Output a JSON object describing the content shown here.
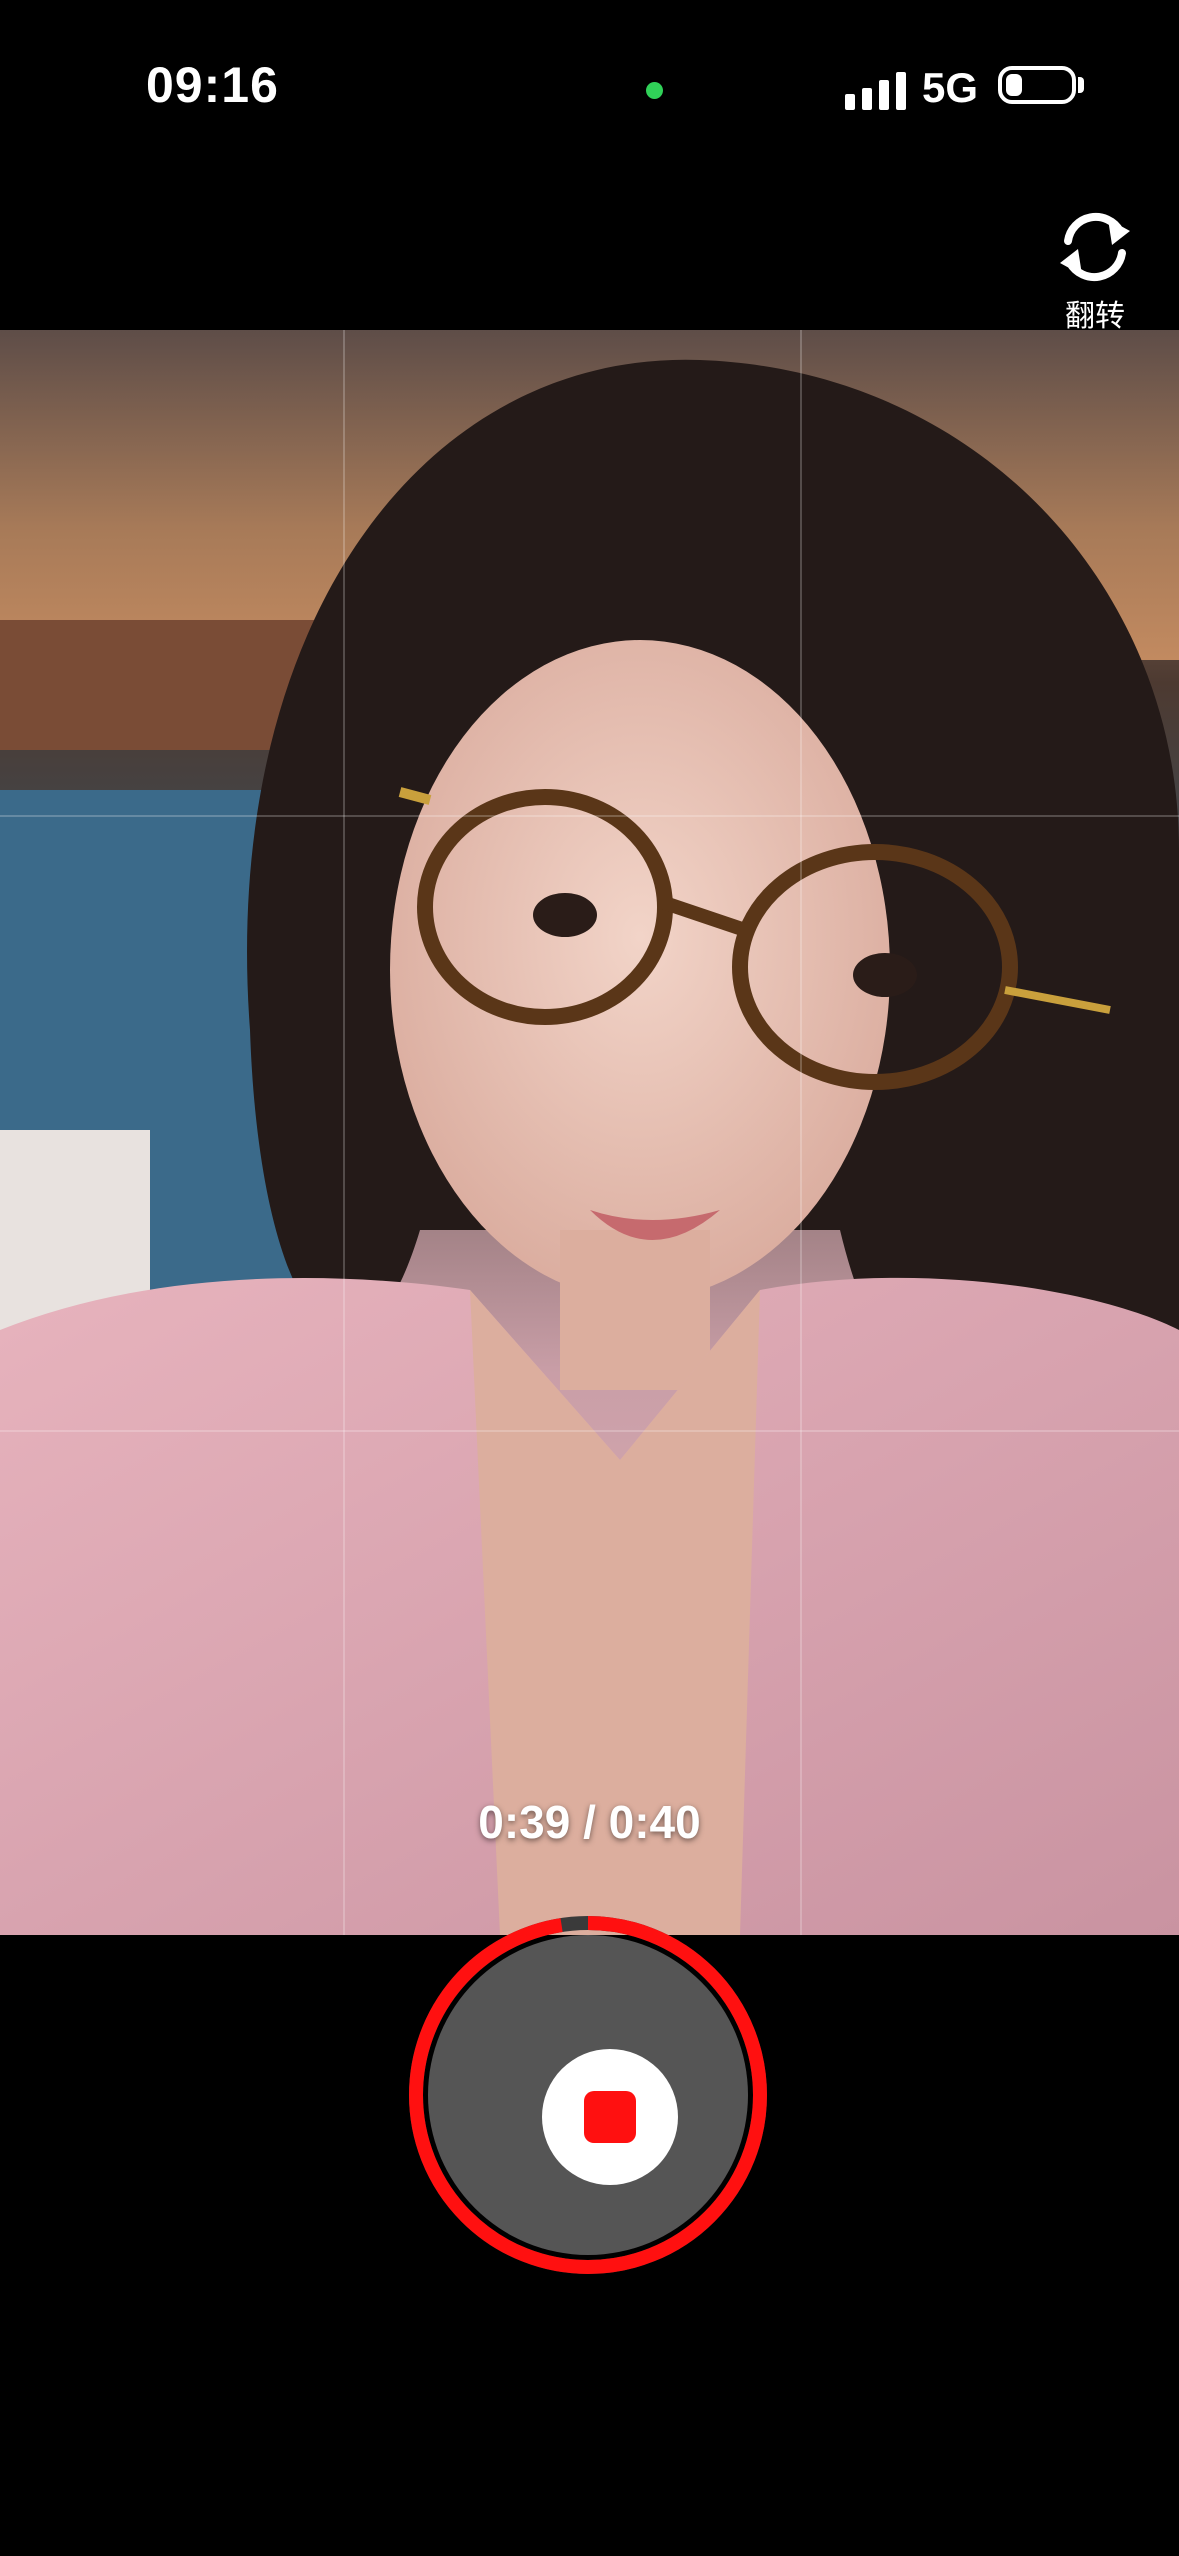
{
  "status_bar": {
    "time": "09:16",
    "network": "5G",
    "battery_level": 0.25,
    "camera_indicator_color": "#30d158"
  },
  "top_controls": {
    "flip_label": "翻转",
    "flip_icon": "camera-flip-icon"
  },
  "viewfinder": {
    "grid": "3x3",
    "content": "camera-preview"
  },
  "recording": {
    "elapsed": "0:39",
    "total": "0:40",
    "timer_text": "0:39 / 0:40",
    "progress": 0.975,
    "ring_color": "#ff1010",
    "state": "recording"
  }
}
